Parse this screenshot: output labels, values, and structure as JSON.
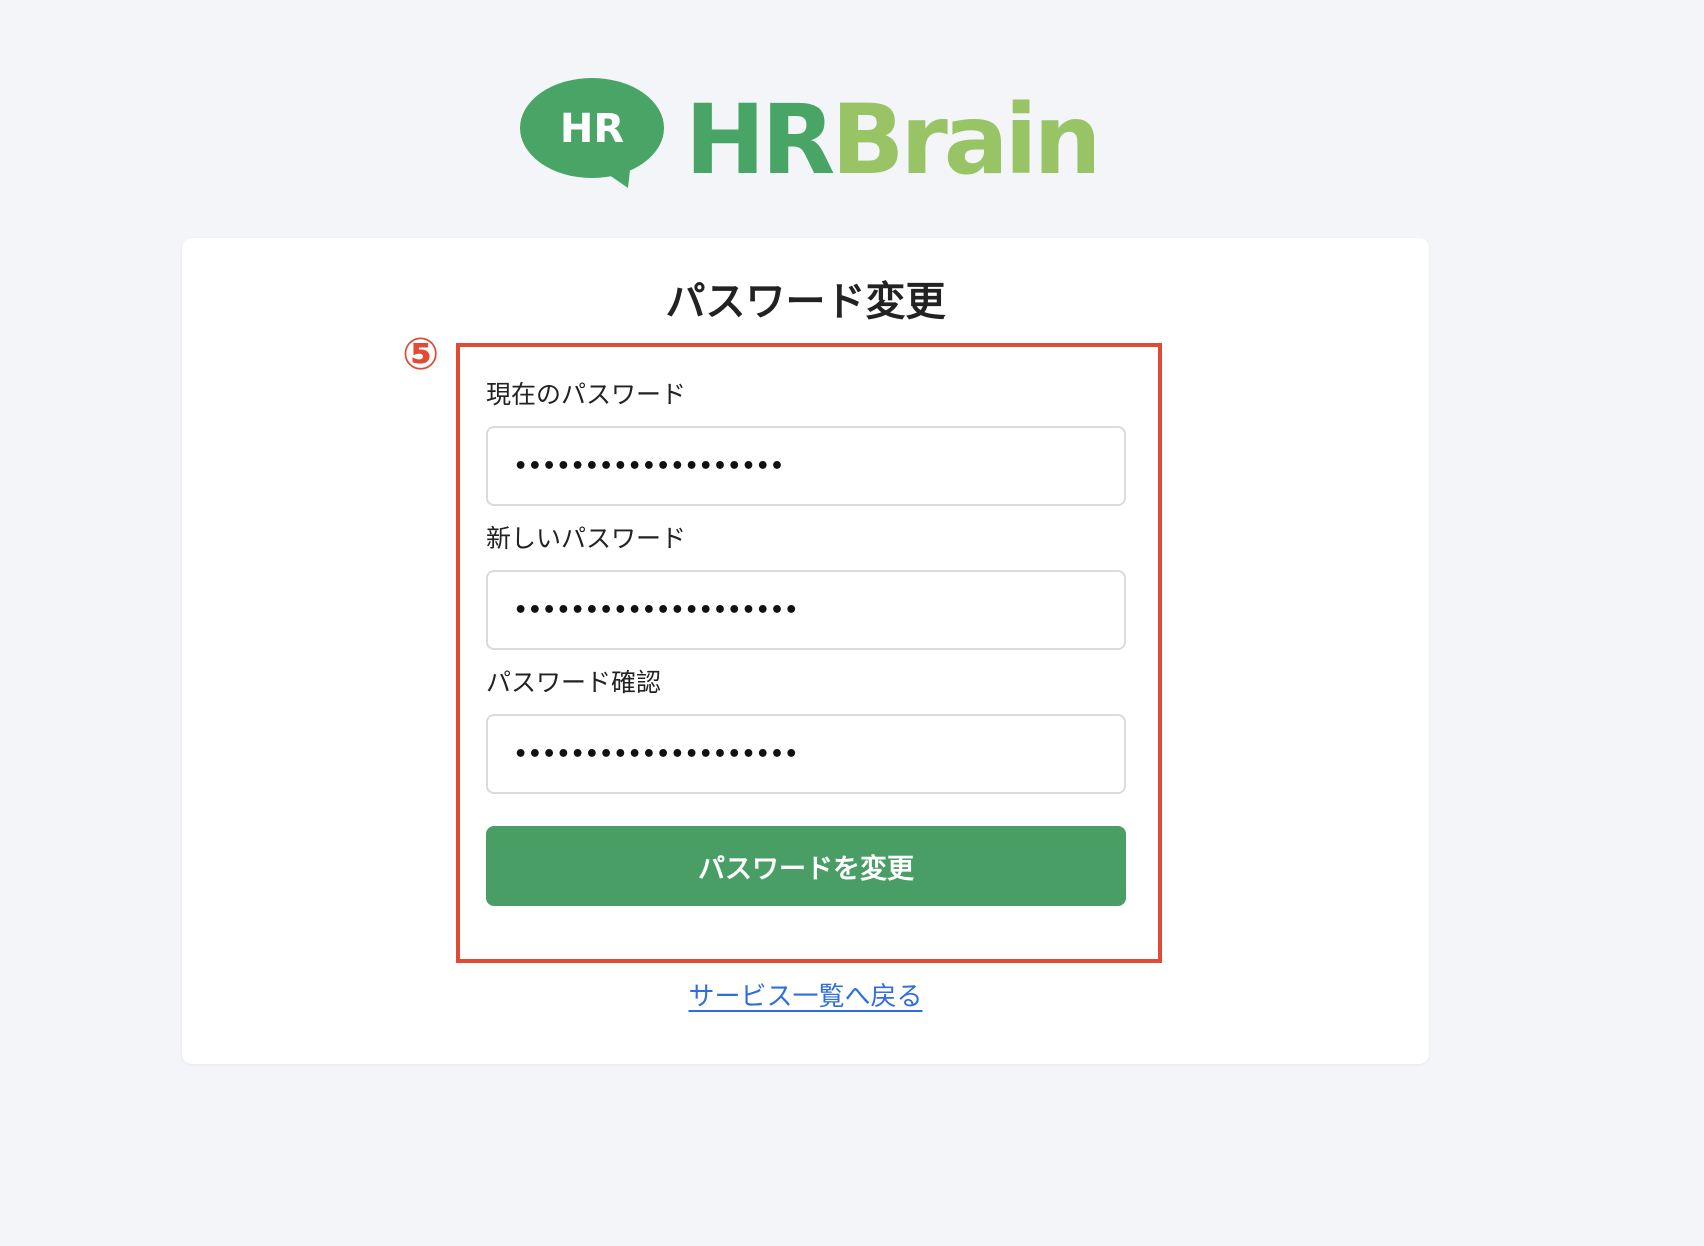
{
  "logo": {
    "badge_text": "HR",
    "wordmark_part1": "HR",
    "wordmark_part2": "Brain",
    "colors": {
      "dark_green": "#48a566",
      "light_green": "#98c466"
    }
  },
  "page": {
    "title": "パスワード変更",
    "annotation_number": "⑤"
  },
  "form": {
    "current_password": {
      "label": "現在のパスワード",
      "value": "•••••••••••••••••••"
    },
    "new_password": {
      "label": "新しいパスワード",
      "value": "••••••••••••••••••••"
    },
    "confirm_password": {
      "label": "パスワード確認",
      "value": "••••••••••••••••••••"
    },
    "submit_label": "パスワードを変更"
  },
  "footer": {
    "back_link_label": "サービス一覧へ戻る"
  },
  "colors": {
    "background": "#f4f5f8",
    "primary_button": "#489e64",
    "link": "#2f6de0",
    "highlight": "#e14a34"
  }
}
